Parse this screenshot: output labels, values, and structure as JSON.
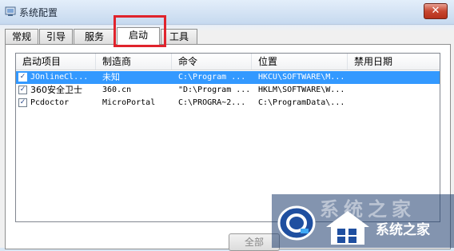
{
  "window": {
    "title": "系统配置",
    "close_label": "✕"
  },
  "tabs": [
    {
      "label": "常规"
    },
    {
      "label": "引导"
    },
    {
      "label": "服务"
    },
    {
      "label": "启动"
    },
    {
      "label": "工具"
    }
  ],
  "columns": [
    "启动项目",
    "制造商",
    "命令",
    "位置",
    "禁用日期"
  ],
  "rows": [
    {
      "item": "JOnlineCl...",
      "maker": "未知",
      "command": "C:\\Program ...",
      "location": "HKCU\\SOFTWARE\\M...",
      "date": "",
      "checked": true,
      "selected": true
    },
    {
      "item": "360安全卫士",
      "maker": "360.cn",
      "command": "\"D:\\Program ...",
      "location": "HKLM\\SOFTWARE\\W...",
      "date": "",
      "checked": true,
      "selected": false
    },
    {
      "item": "Pcdoctor",
      "maker": "MicroPortal",
      "command": "C:\\PROGRA~2...",
      "location": "C:\\ProgramData\\...",
      "date": "",
      "checked": true,
      "selected": false
    }
  ],
  "buttons": {
    "enable_all": "全部"
  },
  "watermark": {
    "text": "系统之家",
    "faded": "系统之家"
  }
}
